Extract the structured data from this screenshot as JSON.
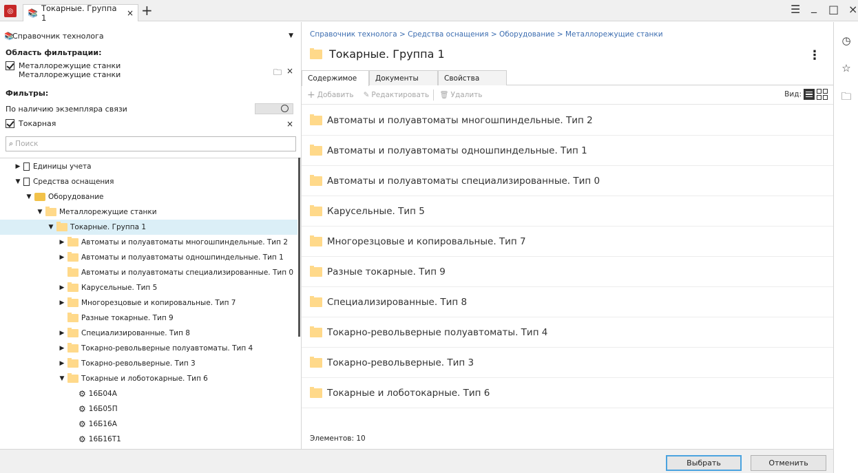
{
  "titlebar": {
    "tab_title": "Токарные. Группа 1",
    "tab_close": "×",
    "tab_add": "+",
    "menu": "☰",
    "minimize": "_",
    "maximize": "□",
    "close": "×"
  },
  "left": {
    "reference_label": "Справочник технолога",
    "filter_area_label": "Область фильтрации:",
    "filter_area_line1": "Металлорежущие станки",
    "filter_area_line2": "Металлорежущие станки",
    "filters_label": "Фильтры:",
    "filter_link_label": "По наличию экземпляра связи",
    "filter_tag_label": "Токарная",
    "filter_tag_close": "×",
    "filter_area_close": "×",
    "search_placeholder": "Поиск",
    "tree": [
      {
        "label": "Единицы учета",
        "level": 0,
        "expanded": false,
        "icon": "document-icon",
        "has_children": true
      },
      {
        "label": "Средства оснащения",
        "level": 0,
        "expanded": true,
        "icon": "document-icon",
        "has_children": true
      },
      {
        "label": "Оборудование",
        "level": 1,
        "expanded": true,
        "icon": "equipment-icon",
        "has_children": true
      },
      {
        "label": "Металлорежущие станки",
        "level": 2,
        "expanded": true,
        "icon": "folder-icon",
        "has_children": true
      },
      {
        "label": "Токарные. Группа 1",
        "level": 3,
        "expanded": true,
        "icon": "folder-icon",
        "has_children": true,
        "selected": true
      },
      {
        "label": "Автоматы и полуавтоматы многошпиндельные. Тип 2",
        "level": 4,
        "expanded": false,
        "icon": "folder-icon",
        "has_children": true
      },
      {
        "label": "Автоматы и полуавтоматы одношпиндельные. Тип 1",
        "level": 4,
        "expanded": false,
        "icon": "folder-icon",
        "has_children": true
      },
      {
        "label": "Автоматы и полуавтоматы специализированные. Тип 0",
        "level": 4,
        "expanded": false,
        "icon": "folder-icon",
        "has_children": false
      },
      {
        "label": "Карусельные. Тип 5",
        "level": 4,
        "expanded": false,
        "icon": "folder-icon",
        "has_children": true
      },
      {
        "label": "Многорезцовые и копировальные. Тип 7",
        "level": 4,
        "expanded": false,
        "icon": "folder-icon",
        "has_children": true
      },
      {
        "label": "Разные токарные. Тип 9",
        "level": 4,
        "expanded": false,
        "icon": "folder-icon",
        "has_children": false
      },
      {
        "label": "Специализированные. Тип 8",
        "level": 4,
        "expanded": false,
        "icon": "folder-icon",
        "has_children": true
      },
      {
        "label": "Токарно-револьверные полуавтоматы. Тип 4",
        "level": 4,
        "expanded": false,
        "icon": "folder-icon",
        "has_children": true
      },
      {
        "label": "Токарно-револьверные. Тип 3",
        "level": 4,
        "expanded": false,
        "icon": "folder-icon",
        "has_children": true
      },
      {
        "label": "Токарные и лоботокарные. Тип 6",
        "level": 4,
        "expanded": true,
        "icon": "folder-icon",
        "has_children": true
      },
      {
        "label": "16Б04А",
        "level": 5,
        "expanded": false,
        "icon": "machine-item-icon",
        "has_children": false
      },
      {
        "label": "16Б05П",
        "level": 5,
        "expanded": false,
        "icon": "machine-item-icon",
        "has_children": false
      },
      {
        "label": "16Б16А",
        "level": 5,
        "expanded": false,
        "icon": "machine-item-icon",
        "has_children": false
      },
      {
        "label": "16Б16Т1",
        "level": 5,
        "expanded": false,
        "icon": "machine-item-icon",
        "has_children": false
      }
    ]
  },
  "right": {
    "breadcrumb": "Справочник технолога > Средства оснащения > Оборудование > Металлорежущие станки",
    "title": "Токарные. Группа 1",
    "tabs": [
      "Содержимое",
      "Документы",
      "Свойства"
    ],
    "active_tab": 0,
    "toolbar": {
      "add": "Добавить",
      "edit": "Редактировать",
      "delete": "Удалить",
      "view_label": "Вид:"
    },
    "items": [
      "Автоматы и полуавтоматы многошпиндельные. Тип 2",
      "Автоматы и полуавтоматы одношпиндельные. Тип 1",
      "Автоматы и полуавтоматы специализированные. Тип 0",
      "Карусельные. Тип 5",
      "Многорезцовые и копировальные. Тип 7",
      "Разные токарные. Тип 9",
      "Специализированные. Тип 8",
      "Токарно-револьверные полуавтоматы. Тип 4",
      "Токарно-револьверные. Тип 3",
      "Токарные и лоботокарные. Тип 6"
    ],
    "count_label": "Элементов: 10"
  },
  "buttons": {
    "select": "Выбрать",
    "cancel": "Отменить"
  },
  "sidebar_icons": [
    "history-icon",
    "favorites-icon",
    "folder-icon"
  ],
  "colors": {
    "selection": "#dbeff7",
    "folder": "#ffd98a",
    "link": "#3c6db0",
    "brand": "#c62828",
    "primary_border": "#4aa3df"
  }
}
